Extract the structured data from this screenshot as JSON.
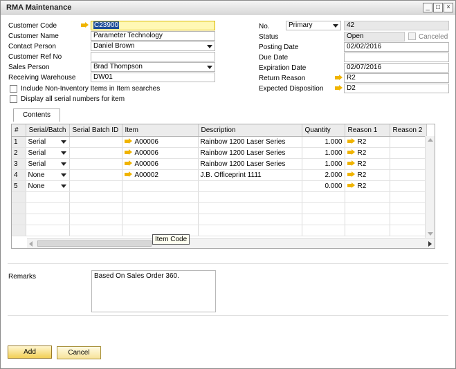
{
  "window": {
    "title": "RMA Maintenance"
  },
  "header": {
    "customer_code_label": "Customer Code",
    "customer_code_value": "C23900",
    "customer_name_label": "Customer Name",
    "customer_name_value": "Parameter Technology",
    "contact_person_label": "Contact Person",
    "contact_person_value": "Daniel Brown",
    "customer_ref_label": "Customer Ref No",
    "customer_ref_value": "",
    "sales_person_label": "Sales Person",
    "sales_person_value": "Brad Thompson",
    "warehouse_label": "Receiving Warehouse",
    "warehouse_value": "DW01",
    "include_noninv_label": "Include Non-Inventory Items in Item searches",
    "display_serials_label": "Display all serial numbers for item",
    "no_label": "No.",
    "series_value": "Primary",
    "no_value": "42",
    "status_label": "Status",
    "status_value": "Open",
    "canceled_label": "Canceled",
    "posting_date_label": "Posting Date",
    "posting_date_value": "02/02/2016",
    "due_date_label": "Due Date",
    "due_date_value": "",
    "expiration_label": "Expiration Date",
    "expiration_value": "02/07/2016",
    "return_reason_label": "Return Reason",
    "return_reason_value": "R2",
    "expected_disp_label": "Expected Disposition",
    "expected_disp_value": "D2"
  },
  "tabs": {
    "contents": "Contents"
  },
  "grid": {
    "columns": [
      "#",
      "Serial/Batch",
      "Serial Batch ID",
      "Item",
      "Description",
      "Quantity",
      "Reason 1",
      "Reason 2"
    ],
    "rows": [
      {
        "num": "1",
        "serial": "Serial",
        "batch_id": "",
        "item": "A00006",
        "desc": "Rainbow 1200 Laser Series",
        "qty": "1.000",
        "reason1": "R2",
        "reason2": ""
      },
      {
        "num": "2",
        "serial": "Serial",
        "batch_id": "",
        "item": "A00006",
        "desc": "Rainbow 1200 Laser Series",
        "qty": "1.000",
        "reason1": "R2",
        "reason2": ""
      },
      {
        "num": "3",
        "serial": "Serial",
        "batch_id": "",
        "item": "A00006",
        "desc": "Rainbow 1200 Laser Series",
        "qty": "1.000",
        "reason1": "R2",
        "reason2": ""
      },
      {
        "num": "4",
        "serial": "None",
        "batch_id": "",
        "item": "A00002",
        "desc": "J.B. Officeprint 1111",
        "qty": "2.000",
        "reason1": "R2",
        "reason2": ""
      },
      {
        "num": "5",
        "serial": "None",
        "batch_id": "",
        "item": "",
        "desc": "",
        "qty": "0.000",
        "reason1": "R2",
        "reason2": ""
      }
    ],
    "tooltip": "Item Code"
  },
  "footer": {
    "remarks_label": "Remarks",
    "remarks_value": "Based On Sales Order 360.",
    "add_label": "Add",
    "cancel_label": "Cancel"
  },
  "colors": {
    "active_field": "#fff8b5",
    "arrow": "#f0b400",
    "selection": "#1f4f99"
  }
}
